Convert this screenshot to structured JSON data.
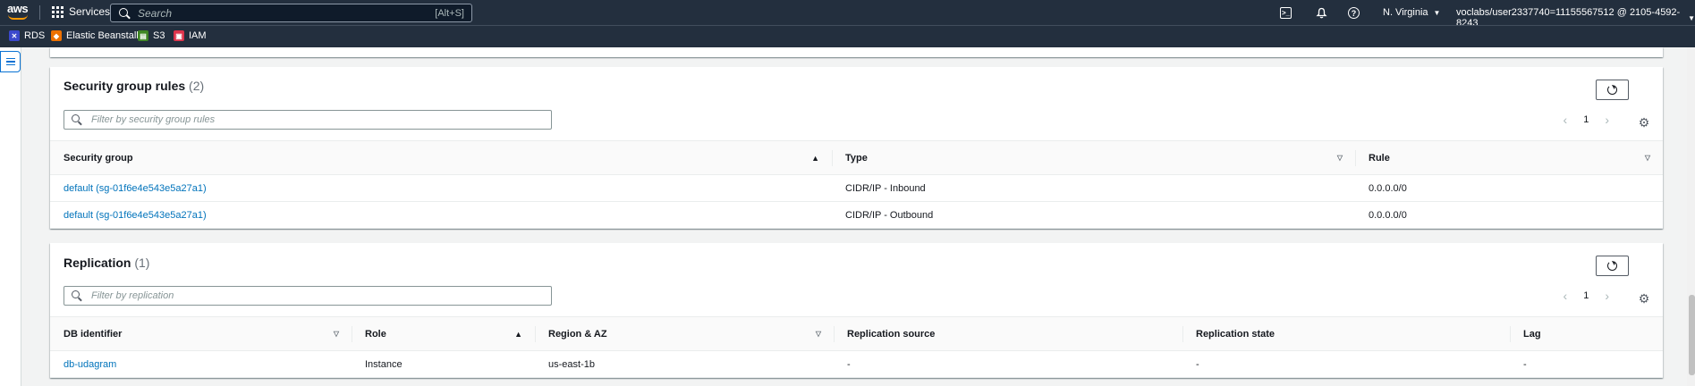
{
  "topnav": {
    "logo": "aws",
    "services_label": "Services",
    "search_placeholder": "Search",
    "search_shortcut": "[Alt+S]",
    "region": "N. Virginia",
    "account": "voclabs/user2337740=11155567512 @ 2105-4592-8243"
  },
  "favorites": [
    {
      "label": "RDS",
      "color": "#3b48cc",
      "icon": "rds-icon"
    },
    {
      "label": "Elastic Beanstalk",
      "color": "#ed7100",
      "icon": "beanstalk-icon"
    },
    {
      "label": "S3",
      "color": "#3f8624",
      "icon": "s3-icon"
    },
    {
      "label": "IAM",
      "color": "#dd344c",
      "icon": "iam-icon"
    }
  ],
  "security_group_rules": {
    "title": "Security group rules",
    "count": "(2)",
    "filter_placeholder": "Filter by security group rules",
    "page": "1",
    "columns": [
      "Security group",
      "Type",
      "Rule"
    ],
    "rows": [
      {
        "security_group": "default (sg-01f6e4e543e5a27a1)",
        "type": "CIDR/IP - Inbound",
        "rule": "0.0.0.0/0"
      },
      {
        "security_group": "default (sg-01f6e4e543e5a27a1)",
        "type": "CIDR/IP - Outbound",
        "rule": "0.0.0.0/0"
      }
    ]
  },
  "replication": {
    "title": "Replication",
    "count": "(1)",
    "filter_placeholder": "Filter by replication",
    "page": "1",
    "columns": [
      "DB identifier",
      "Role",
      "Region & AZ",
      "Replication source",
      "Replication state",
      "Lag"
    ],
    "rows": [
      {
        "db_identifier": "db-udagram",
        "role": "Instance",
        "region_az": "us-east-1b",
        "replication_source": "-",
        "replication_state": "-",
        "lag": "-"
      }
    ]
  }
}
